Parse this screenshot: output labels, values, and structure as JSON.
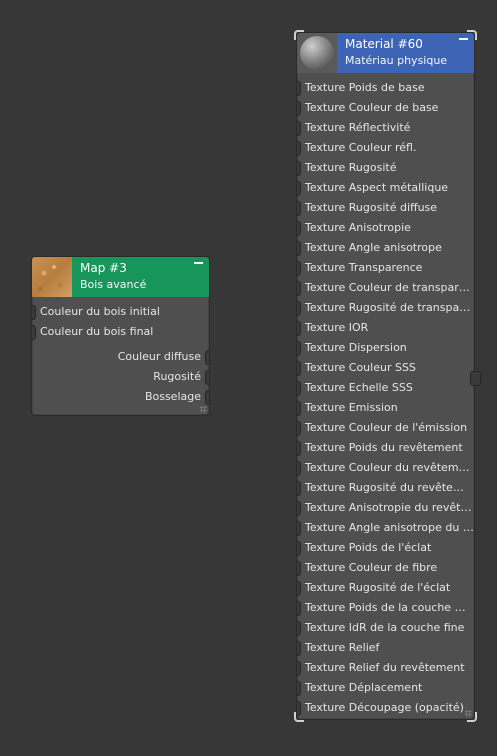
{
  "map_node": {
    "title": "Map #3",
    "subtitle": "Bois avancé",
    "header_color": "#17955a",
    "thumbnail": "wood-texture-thumbnail",
    "inputs": [
      {
        "label": "Couleur du bois initial"
      },
      {
        "label": "Couleur du bois final"
      }
    ],
    "outputs": [
      {
        "label": "Couleur diffuse"
      },
      {
        "label": "Rugosité"
      },
      {
        "label": "Bosselage"
      }
    ]
  },
  "material_node": {
    "title": "Material #60",
    "subtitle": "Matériau physique",
    "header_color": "#3d64b5",
    "thumbnail": "material-sphere-preview",
    "selected": true,
    "inputs": [
      {
        "label": "Texture Poids de base"
      },
      {
        "label": "Texture Couleur de base"
      },
      {
        "label": "Texture Réflectivité"
      },
      {
        "label": "Texture Couleur réfl."
      },
      {
        "label": "Texture Rugosité"
      },
      {
        "label": "Texture Aspect métallique"
      },
      {
        "label": "Texture Rugosité diffuse"
      },
      {
        "label": "Texture Anisotropie"
      },
      {
        "label": "Texture Angle anisotrope"
      },
      {
        "label": "Texture Transparence"
      },
      {
        "label": "Texture Couleur de transpar…"
      },
      {
        "label": "Texture Rugosité de transpa…"
      },
      {
        "label": "Texture IOR"
      },
      {
        "label": "Texture Dispersion"
      },
      {
        "label": "Texture Couleur SSS"
      },
      {
        "label": "Texture Echelle SSS"
      },
      {
        "label": "Texture Emission"
      },
      {
        "label": "Texture Couleur de l'émission"
      },
      {
        "label": "Texture Poids du revêtement"
      },
      {
        "label": "Texture Couleur du revêtem…"
      },
      {
        "label": "Texture Rugosité du revête…"
      },
      {
        "label": "Texture Anisotropie du revêt…"
      },
      {
        "label": "Texture Angle anisotrope du …"
      },
      {
        "label": "Texture Poids de l'éclat"
      },
      {
        "label": "Texture Couleur de fibre"
      },
      {
        "label": "Texture Rugosité de l'éclat"
      },
      {
        "label": "Texture Poids de la couche …"
      },
      {
        "label": "Texture IdR de la couche fine"
      },
      {
        "label": "Texture Relief"
      },
      {
        "label": "Texture Relief du revêtement"
      },
      {
        "label": "Texture Déplacement"
      },
      {
        "label": "Texture Découpage (opacité)"
      }
    ]
  }
}
